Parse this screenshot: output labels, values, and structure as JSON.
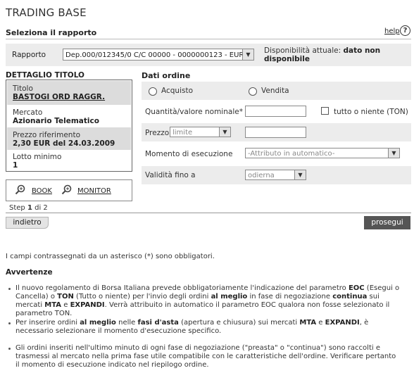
{
  "header": {
    "title": "TRADING BASE"
  },
  "select_report": {
    "heading": "Seleziona il rapporto",
    "help_label": "help",
    "help_icon": "help-icon",
    "rapporto_label": "Rapporto",
    "rapporto_value": "Dep.000/012345/0 C/C 00000 - 0000000123 - EUR",
    "availability_label": "Disponibilità attuale:",
    "availability_value": "dato non disponibile"
  },
  "detail": {
    "heading": "DETTAGLIO TITOLO",
    "titolo_label": "Titolo",
    "titolo_value": "BASTOGI ORD RAGGR.",
    "mercato_label": "Mercato",
    "mercato_value": "Azionario Telematico",
    "prezzo_label": "Prezzo riferimento",
    "prezzo_value": "2,30 EUR del 24.03.2009",
    "lotto_label": "Lotto minimo",
    "lotto_value": "1",
    "book_label": "BOOK",
    "monitor_label": "MONITOR",
    "step_text_prefix": "Step",
    "step_current": "1",
    "step_text_suffix": "di 2"
  },
  "order": {
    "heading": "Dati ordine",
    "acquisto_label": "Acquisto",
    "vendita_label": "Vendita",
    "quantity_label": "Quantità/valore nominale*",
    "quantity_value": "",
    "tutto_label": "tutto o niente (TON)",
    "prezzo_label": "Prezzo",
    "prezzo_type": "limite",
    "prezzo_value": "",
    "momento_label": "Momento di esecuzione",
    "momento_value": "-Attributo in automatico-",
    "validita_label": "Validità fino a",
    "validita_value": "odierna"
  },
  "buttons": {
    "back": "indietro",
    "next": "prosegui"
  },
  "note": "I campi contrassegnati da un asterisco (*) sono obbligatori.",
  "warnings": {
    "heading": "Avvertenze",
    "items": [
      "Il nuovo regolamento di Borsa Italiana prevede obbligatoriamente l'indicazione del parametro EOC (Esegui o Cancella) o TON (Tutto o niente) per l'invio degli ordini al meglio in fase di negoziazione continua sui mercati MTA e EXPANDI. Verrà attribuito in automatico il parametro EOC qualora non fosse selezionato il parametro TON.",
      "Per inserire ordini al meglio nelle fasi d'asta (apertura e chiusura) sui mercati MTA e EXPANDI, è necessario selezionare il momento d'esecuzione specifico.",
      "Gli ordini inseriti nell'ultimo minuto di ogni fase di negoziazione (\"preasta\" o \"continua\") sono raccolti e trasmessi al mercato nella prima fase utile compatibile con le caratteristiche dell'ordine. Verificare pertanto il momento di esecuzione indicato nel riepilogo ordine."
    ]
  }
}
